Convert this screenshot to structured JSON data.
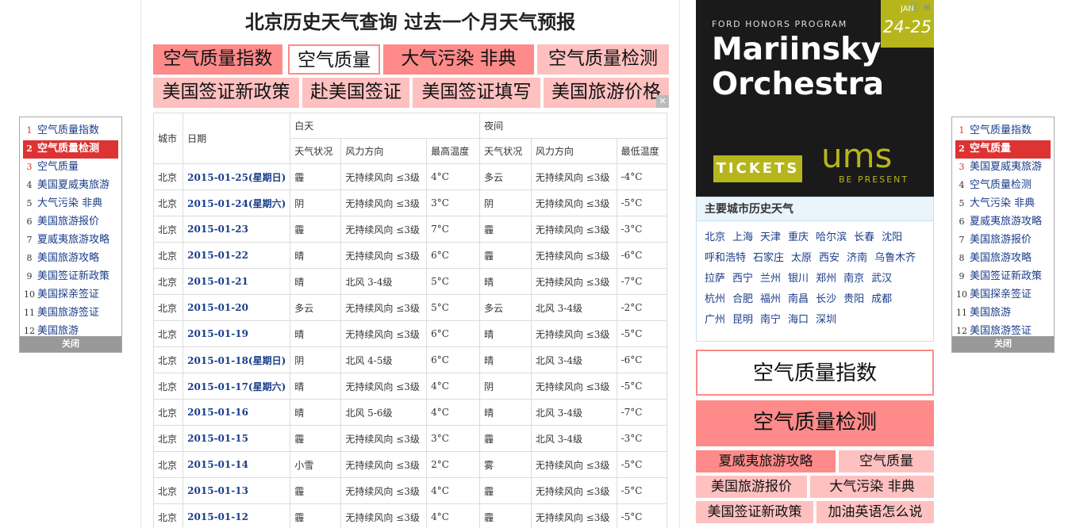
{
  "page_title": "北京历史天气查询 过去一个月天气预报",
  "top_links": {
    "row1": [
      "空气质量指数",
      "空气质量",
      "大气污染 非典",
      "空气质量检测"
    ],
    "row2": [
      "美国签证新政策",
      "赴美国签证",
      "美国签证填写",
      "美国旅游价格"
    ]
  },
  "table": {
    "headers": {
      "city": "城市",
      "date": "日期",
      "day": "白天",
      "night": "夜间",
      "weather": "天气状况",
      "wind": "风力方向",
      "high": "最高温度",
      "low": "最低温度"
    },
    "rows": [
      [
        "北京",
        "2015-01-25(星期日)",
        "霾",
        "无持续风向 ≤3级",
        "4°C",
        "多云",
        "无持续风向 ≤3级",
        "-4°C"
      ],
      [
        "北京",
        "2015-01-24(星期六)",
        "阴",
        "无持续风向 ≤3级",
        "3°C",
        "阴",
        "无持续风向 ≤3级",
        "-5°C"
      ],
      [
        "北京",
        "2015-01-23",
        "霾",
        "无持续风向 ≤3级",
        "7°C",
        "霾",
        "无持续风向 ≤3级",
        "-3°C"
      ],
      [
        "北京",
        "2015-01-22",
        "晴",
        "无持续风向 ≤3级",
        "6°C",
        "霾",
        "无持续风向 ≤3级",
        "-6°C"
      ],
      [
        "北京",
        "2015-01-21",
        "晴",
        "北风 3-4级",
        "5°C",
        "晴",
        "无持续风向 ≤3级",
        "-7°C"
      ],
      [
        "北京",
        "2015-01-20",
        "多云",
        "无持续风向 ≤3级",
        "5°C",
        "多云",
        "北风 3-4级",
        "-2°C"
      ],
      [
        "北京",
        "2015-01-19",
        "晴",
        "无持续风向 ≤3级",
        "6°C",
        "晴",
        "无持续风向 ≤3级",
        "-5°C"
      ],
      [
        "北京",
        "2015-01-18(星期日)",
        "阴",
        "北风 4-5级",
        "6°C",
        "晴",
        "北风 3-4级",
        "-6°C"
      ],
      [
        "北京",
        "2015-01-17(星期六)",
        "晴",
        "无持续风向 ≤3级",
        "4°C",
        "阴",
        "无持续风向 ≤3级",
        "-5°C"
      ],
      [
        "北京",
        "2015-01-16",
        "晴",
        "北风 5-6级",
        "4°C",
        "晴",
        "北风 3-4级",
        "-7°C"
      ],
      [
        "北京",
        "2015-01-15",
        "霾",
        "无持续风向 ≤3级",
        "3°C",
        "霾",
        "北风 3-4级",
        "-3°C"
      ],
      [
        "北京",
        "2015-01-14",
        "小雪",
        "无持续风向 ≤3级",
        "2°C",
        "雾",
        "无持续风向 ≤3级",
        "-5°C"
      ],
      [
        "北京",
        "2015-01-13",
        "霾",
        "无持续风向 ≤3级",
        "4°C",
        "霾",
        "无持续风向 ≤3级",
        "-5°C"
      ],
      [
        "北京",
        "2015-01-12",
        "霾",
        "无持续风向 ≤3级",
        "4°C",
        "霾",
        "无持续风向 ≤3级",
        "-5°C"
      ]
    ]
  },
  "ad": {
    "program": "FORD HONORS PROGRAM",
    "line1": "Mariinsky",
    "line2": "Orchestra",
    "month": "JAN",
    "days": "24-25",
    "tickets": "TICKETS",
    "brand": "ums",
    "tagline": "BE PRESENT"
  },
  "cities": {
    "title": "主要城市历史天气",
    "list": [
      "北京",
      "上海",
      "天津",
      "重庆",
      "哈尔滨",
      "长春",
      "沈阳",
      "呼和浩特",
      "石家庄",
      "太原",
      "西安",
      "济南",
      "乌鲁木齐",
      "拉萨",
      "西宁",
      "兰州",
      "银川",
      "郑州",
      "南京",
      "武汉",
      "杭州",
      "合肥",
      "福州",
      "南昌",
      "长沙",
      "贵阳",
      "成都",
      "广州",
      "昆明",
      "南宁",
      "海口",
      "深圳"
    ]
  },
  "right_links": {
    "big1": "空气质量指数",
    "big2": "空气质量检测",
    "small": [
      "夏威夷旅游攻略",
      "空气质量",
      "美国旅游报价",
      "大气污染 非典",
      "美国签证新政策",
      "加油英语怎么说"
    ]
  },
  "float_left": {
    "items": [
      "空气质量指数",
      "空气质量检测",
      "空气质量",
      "美国夏威夷旅游",
      "大气污染 非典",
      "美国旅游报价",
      "夏威夷旅游攻略",
      "美国旅游攻略",
      "美国签证新政策",
      "美国探亲签证",
      "美国旅游签证",
      "美国旅游"
    ],
    "selected": 1,
    "close": "关闭"
  },
  "float_right": {
    "items": [
      "空气质量指数",
      "空气质量",
      "美国夏威夷旅游",
      "空气质量检测",
      "大气污染 非典",
      "夏威夷旅游攻略",
      "美国旅游报价",
      "美国旅游攻略",
      "美国签证新政策",
      "美国探亲签证",
      "美国旅游",
      "美国旅游签证"
    ],
    "selected": 1,
    "close": "关闭"
  },
  "colors": {
    "accent_strong": "#ff8a8a",
    "accent_pink": "#ffc0c0",
    "link": "#1a3d8a",
    "selected": "#dd3333",
    "ad_olive": "#b6b61c"
  }
}
